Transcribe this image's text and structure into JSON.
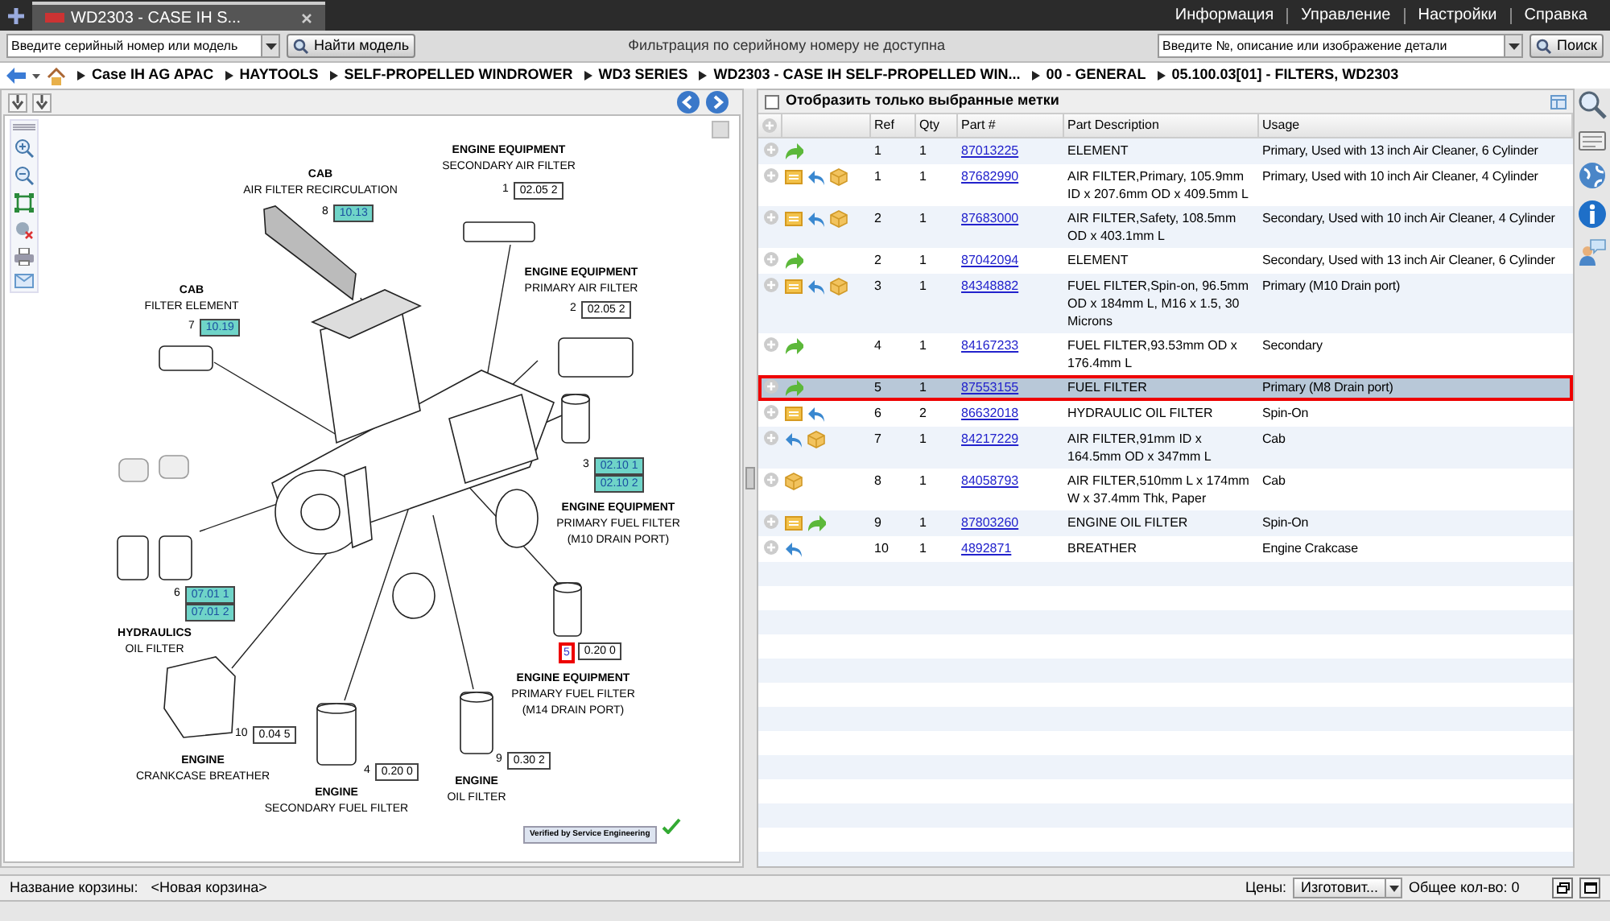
{
  "browser_tab": {
    "title": "WD2303 - CASE IH S..."
  },
  "top_menu": [
    "Информация",
    "Управление",
    "Настройки",
    "Справка"
  ],
  "toolbar": {
    "serial_field": {
      "placeholder": "Введите серийный номер или модель"
    },
    "find_button": "Найти модель",
    "filter_notice": "Фильтрация по серийному номеру не доступна",
    "search_field": {
      "placeholder": "Введите №, описание или изображение детали"
    },
    "search_button": "Поиск"
  },
  "breadcrumbs": [
    "Case IH AG APAC",
    "HAYTOOLS",
    "SELF-PROPELLED WINDROWER",
    "WD3 SERIES",
    "WD2303 - CASE IH SELF-PROPELLED WIN...",
    "00 - GENERAL",
    "05.100.03[01] - FILTERS, WD2303"
  ],
  "diagram": {
    "callouts": [
      {
        "title": "CAB",
        "subtitle": [
          "AIR FILTER RECIRCULATION"
        ],
        "ref": "8",
        "selected": false,
        "codes": [
          {
            "text": "10.13",
            "highlighted": true
          }
        ]
      },
      {
        "title": "ENGINE EQUIPMENT",
        "subtitle": [
          "SECONDARY AIR FILTER"
        ],
        "ref": "1",
        "selected": false,
        "codes": [
          {
            "text": "02.05 2",
            "highlighted": false
          }
        ]
      },
      {
        "title": "CAB",
        "subtitle": [
          "FILTER ELEMENT"
        ],
        "ref": "7",
        "selected": false,
        "codes": [
          {
            "text": "10.19",
            "highlighted": true
          }
        ]
      },
      {
        "title": "ENGINE EQUIPMENT",
        "subtitle": [
          "PRIMARY AIR FILTER"
        ],
        "ref": "2",
        "selected": false,
        "codes": [
          {
            "text": "02.05 2",
            "highlighted": false
          }
        ]
      },
      {
        "title": "ENGINE EQUIPMENT",
        "subtitle": [
          "PRIMARY FUEL FILTER",
          "(M10 DRAIN PORT)"
        ],
        "ref": "3",
        "selected": false,
        "codes": [
          {
            "text": "02.10 1",
            "highlighted": true
          },
          {
            "text": "02.10 2",
            "highlighted": true
          }
        ]
      },
      {
        "title": "HYDRAULICS",
        "subtitle": [
          "OIL FILTER"
        ],
        "ref": "6",
        "selected": false,
        "codes": [
          {
            "text": "07.01 1",
            "highlighted": true
          },
          {
            "text": "07.01 2",
            "highlighted": true
          }
        ]
      },
      {
        "title": "ENGINE EQUIPMENT",
        "subtitle": [
          "PRIMARY FUEL FILTER",
          "(M14 DRAIN PORT)"
        ],
        "ref": "5",
        "selected": true,
        "codes": [
          {
            "text": "0.20 0",
            "highlighted": false
          }
        ]
      },
      {
        "title": "ENGINE",
        "subtitle": [
          "CRANKCASE BREATHER"
        ],
        "ref": "10",
        "selected": false,
        "codes": [
          {
            "text": "0.04 5",
            "highlighted": false
          }
        ]
      },
      {
        "title": "ENGINE",
        "subtitle": [
          "SECONDARY FUEL FILTER"
        ],
        "ref": "4",
        "selected": false,
        "codes": [
          {
            "text": "0.20 0",
            "highlighted": false
          }
        ]
      },
      {
        "title": "ENGINE",
        "subtitle": [
          "OIL FILTER"
        ],
        "ref": "9",
        "selected": false,
        "codes": [
          {
            "text": "0.30 2",
            "highlighted": false
          }
        ]
      }
    ],
    "verified_badge": "Verified by Service Engineering"
  },
  "parts_list": {
    "show_selected_only": {
      "label": "Отобразить только выбранные метки",
      "checked": false
    },
    "columns": [
      "Ref",
      "Qty",
      "Part #",
      "Part Description",
      "Usage"
    ],
    "rows": [
      {
        "icons": [
          {
            "kind": "forward"
          }
        ],
        "ref": "1",
        "qty": "1",
        "part": "87013225",
        "description": "ELEMENT",
        "usage": "Primary, Used with 13 inch Air Cleaner, 6 Cylinder",
        "selected": false
      },
      {
        "icons": [
          {
            "kind": "note"
          },
          {
            "kind": "back"
          },
          {
            "kind": "box"
          }
        ],
        "ref": "1",
        "qty": "1",
        "part": "87682990",
        "description": "AIR FILTER,Primary, 105.9mm ID x 207.6mm OD x 409.5mm L",
        "usage": "Primary, Used with 10 inch Air Cleaner, 4 Cylinder",
        "selected": false
      },
      {
        "icons": [
          {
            "kind": "note"
          },
          {
            "kind": "back"
          },
          {
            "kind": "box"
          }
        ],
        "ref": "2",
        "qty": "1",
        "part": "87683000",
        "description": "AIR FILTER,Safety, 108.5mm OD x 403.1mm L",
        "usage": "Secondary, Used with 10 inch Air Cleaner, 4 Cylinder",
        "selected": false
      },
      {
        "icons": [
          {
            "kind": "forward"
          }
        ],
        "ref": "2",
        "qty": "1",
        "part": "87042094",
        "description": "ELEMENT",
        "usage": "Secondary, Used with 13 inch Air Cleaner, 6 Cylinder",
        "selected": false
      },
      {
        "icons": [
          {
            "kind": "note"
          },
          {
            "kind": "back"
          },
          {
            "kind": "box"
          }
        ],
        "ref": "3",
        "qty": "1",
        "part": "84348882",
        "description": "FUEL FILTER,Spin-on, 96.5mm OD x 184mm L, M16 x 1.5, 30 Microns",
        "usage": "Primary (M10 Drain port)",
        "selected": false
      },
      {
        "icons": [
          {
            "kind": "forward"
          }
        ],
        "ref": "4",
        "qty": "1",
        "part": "84167233",
        "description": "FUEL FILTER,93.53mm OD x 176.4mm L",
        "usage": "Secondary",
        "selected": false
      },
      {
        "icons": [
          {
            "kind": "forward"
          }
        ],
        "ref": "5",
        "qty": "1",
        "part": "87553155",
        "description": "FUEL FILTER",
        "usage": "Primary (M8 Drain port)",
        "selected": true
      },
      {
        "icons": [
          {
            "kind": "note"
          },
          {
            "kind": "back"
          }
        ],
        "ref": "6",
        "qty": "2",
        "part": "86632018",
        "description": "HYDRAULIC OIL FILTER",
        "usage": "Spin-On",
        "selected": false
      },
      {
        "icons": [
          {
            "kind": "back"
          },
          {
            "kind": "box"
          }
        ],
        "ref": "7",
        "qty": "1",
        "part": "84217229",
        "description": "AIR FILTER,91mm ID x 164.5mm OD x 347mm L",
        "usage": "Cab",
        "selected": false
      },
      {
        "icons": [
          {
            "kind": "box"
          }
        ],
        "ref": "8",
        "qty": "1",
        "part": "84058793",
        "description": "AIR FILTER,510mm L x 174mm W x 37.4mm Thk, Paper",
        "usage": "Cab",
        "selected": false
      },
      {
        "icons": [
          {
            "kind": "note"
          },
          {
            "kind": "forward"
          }
        ],
        "ref": "9",
        "qty": "1",
        "part": "87803260",
        "description": "ENGINE OIL FILTER",
        "usage": "Spin-On",
        "selected": false
      },
      {
        "icons": [
          {
            "kind": "back"
          }
        ],
        "ref": "10",
        "qty": "1",
        "part": "4892871",
        "description": "BREATHER",
        "usage": "Engine Crakcase",
        "selected": false
      }
    ]
  },
  "status_bar": {
    "basket_label": "Название корзины:",
    "basket_name": "<Новая корзина>",
    "prices_label": "Цены:",
    "prices_select": "Изготовит...",
    "total": "Общее кол-во: 0"
  }
}
